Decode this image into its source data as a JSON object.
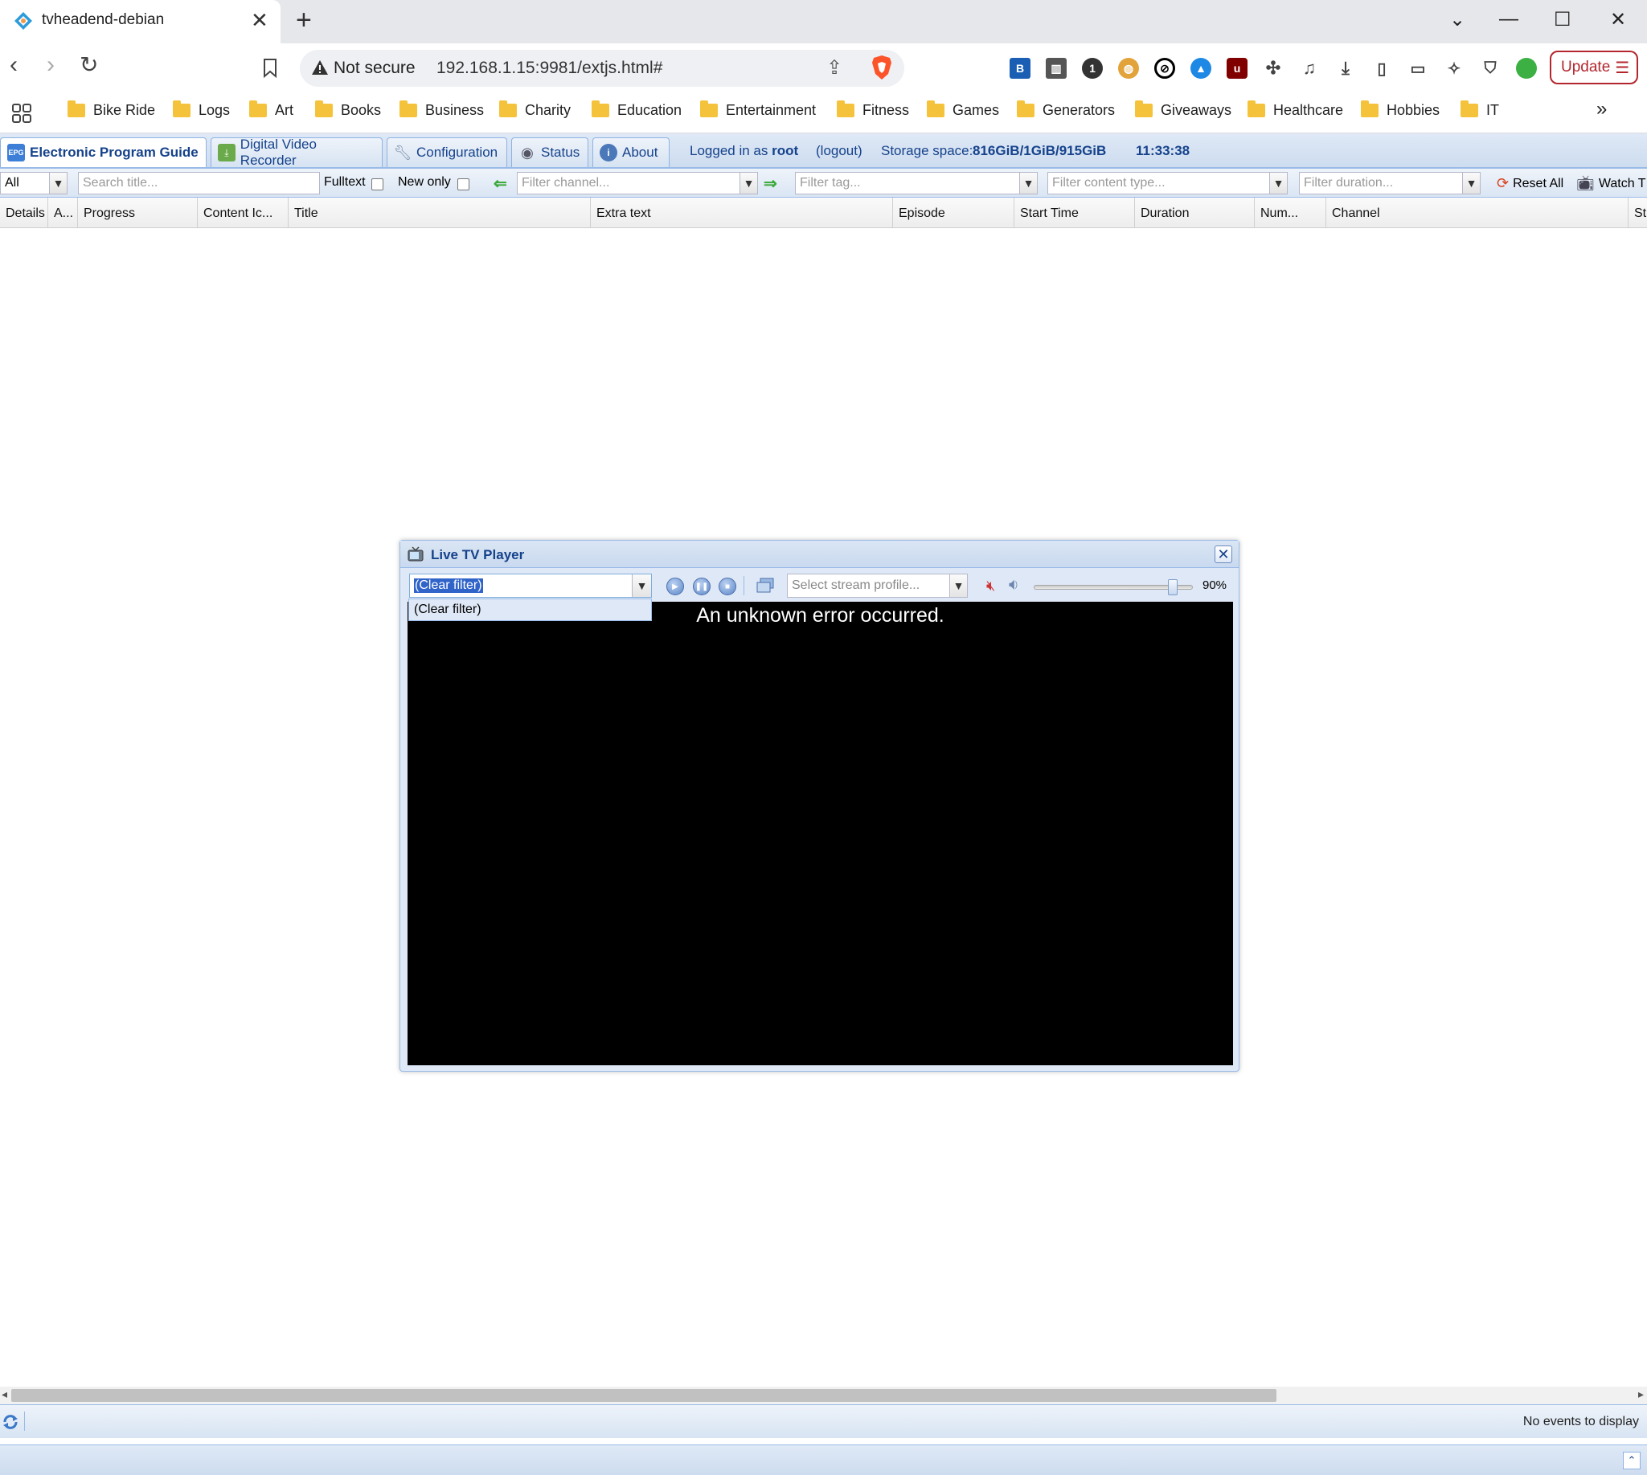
{
  "browser": {
    "tab_title": "tvheadend-debian",
    "tab_close": "✕",
    "new_tab": "+",
    "not_secure": "Not secure",
    "url": "192.168.1.15:9981/extjs.html#",
    "update_label": "Update",
    "win_minimize": "—",
    "win_maximize": "☐",
    "win_close": "✕",
    "win_dropdown": "⌄",
    "bookmarks": [
      "Bike Ride",
      "Logs",
      "Art",
      "Books",
      "Business",
      "Charity",
      "Education",
      "Entertainment",
      "Fitness",
      "Games",
      "Generators",
      "Giveaways",
      "Healthcare",
      "Hobbies",
      "IT"
    ],
    "bookmarks_more": "»",
    "brand_color": "#15428b"
  },
  "app": {
    "tabs": {
      "epg": "Electronic Program Guide",
      "dvr": "Digital Video Recorder",
      "config": "Configuration",
      "status": "Status",
      "about": "About"
    },
    "logged_in_prefix": "Logged in as",
    "user": "root",
    "logout": "(logout)",
    "storage_label": "Storage space:",
    "storage_value": "816GiB/1GiB/915GiB",
    "clock": "11:33:38"
  },
  "filters": {
    "mode_value": "All",
    "search_placeholder": "Search title...",
    "fulltext_label": "Fulltext",
    "new_only_label": "New only",
    "channel_placeholder": "Filter channel...",
    "tag_placeholder": "Filter tag...",
    "content_type_placeholder": "Filter content type...",
    "duration_placeholder": "Filter duration...",
    "reset_all": "Reset All",
    "watch_tv": "Watch T"
  },
  "grid": {
    "columns": [
      "Details",
      "A...",
      "Progress",
      "Content Ic...",
      "Title",
      "Extra text",
      "Episode",
      "Start Time",
      "Duration",
      "Num...",
      "Channel",
      "St"
    ],
    "no_events": "No events to display"
  },
  "player": {
    "title": "Live TV Player",
    "channel_value": "(Clear filter)",
    "dropdown_items": [
      "(Clear filter)"
    ],
    "stream_placeholder": "Select stream profile...",
    "volume_pct": "90%",
    "volume_level": 0.9,
    "error": "An unknown error occurred.",
    "close": "✕"
  }
}
